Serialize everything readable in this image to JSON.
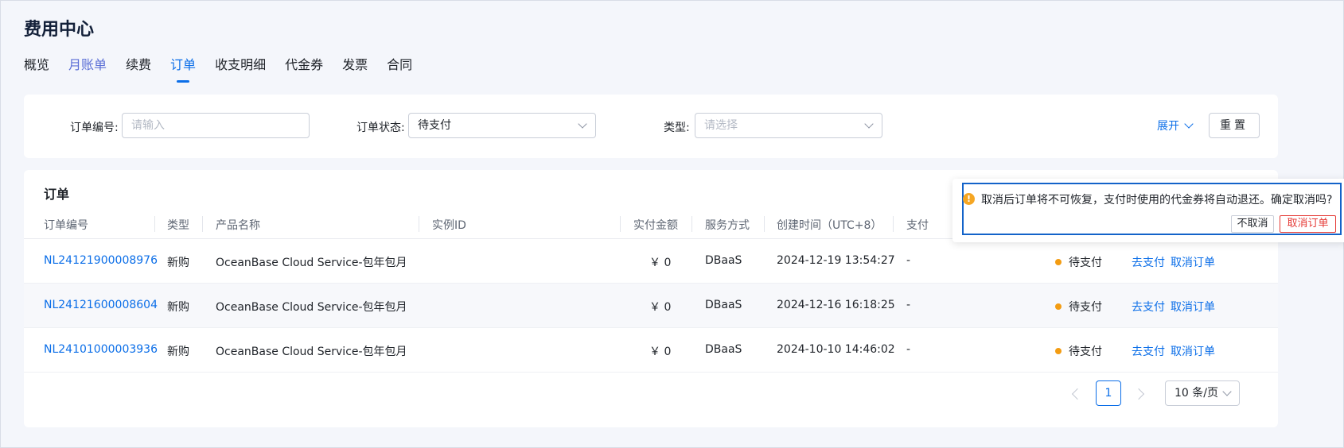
{
  "page": {
    "title": "费用中心"
  },
  "tabs": [
    {
      "label": "概览"
    },
    {
      "label": "月账单"
    },
    {
      "label": "续费"
    },
    {
      "label": "订单"
    },
    {
      "label": "收支明细"
    },
    {
      "label": "代金券"
    },
    {
      "label": "发票"
    },
    {
      "label": "合同"
    }
  ],
  "active_tab": "订单",
  "filters": {
    "order_no_label": "订单编号:",
    "order_no_placeholder": "请输入",
    "status_label": "订单状态:",
    "status_value": "待支付",
    "type_label": "类型:",
    "type_placeholder": "请选择",
    "expand_label": "展开",
    "reset_label": "重置"
  },
  "table": {
    "title": "订单",
    "columns": [
      "订单编号",
      "类型",
      "产品名称",
      "实例ID",
      "实付金额",
      "服务方式",
      "创建时间（UTC+8）",
      "支付"
    ],
    "rows": [
      {
        "order_no": "NL24121900008976",
        "type": "新购",
        "product": "OceanBase Cloud Service-包年包月",
        "instance_id": "",
        "amount": "￥ 0",
        "service": "DBaaS",
        "created": "2024-12-19 13:54:27",
        "pay_time": "-",
        "status": "待支付",
        "action_pay": "去支付",
        "action_cancel": "取消订单"
      },
      {
        "order_no": "NL24121600008604",
        "type": "新购",
        "product": "OceanBase Cloud Service-包年包月",
        "instance_id": "",
        "amount": "￥ 0",
        "service": "DBaaS",
        "created": "2024-12-16 16:18:25",
        "pay_time": "-",
        "status": "待支付",
        "action_pay": "去支付",
        "action_cancel": "取消订单"
      },
      {
        "order_no": "NL24101000003936",
        "type": "新购",
        "product": "OceanBase Cloud Service-包年包月",
        "instance_id": "",
        "amount": "￥ 0",
        "service": "DBaaS",
        "created": "2024-10-10 14:46:02",
        "pay_time": "-",
        "status": "待支付",
        "action_pay": "去支付",
        "action_cancel": "取消订单"
      }
    ],
    "status_color": "#f39c12"
  },
  "pagination": {
    "current_page": "1",
    "page_size_label": "10 条/页"
  },
  "popconfirm": {
    "icon": "warning-icon",
    "message": "取消后订单将不可恢复，支付时使用的代金券将自动退还。确定取消吗?",
    "cancel_label": "不取消",
    "confirm_label": "取消订单"
  },
  "colors": {
    "primary": "#0b6ee8",
    "danger": "#e53935",
    "warning": "#f39c12"
  }
}
